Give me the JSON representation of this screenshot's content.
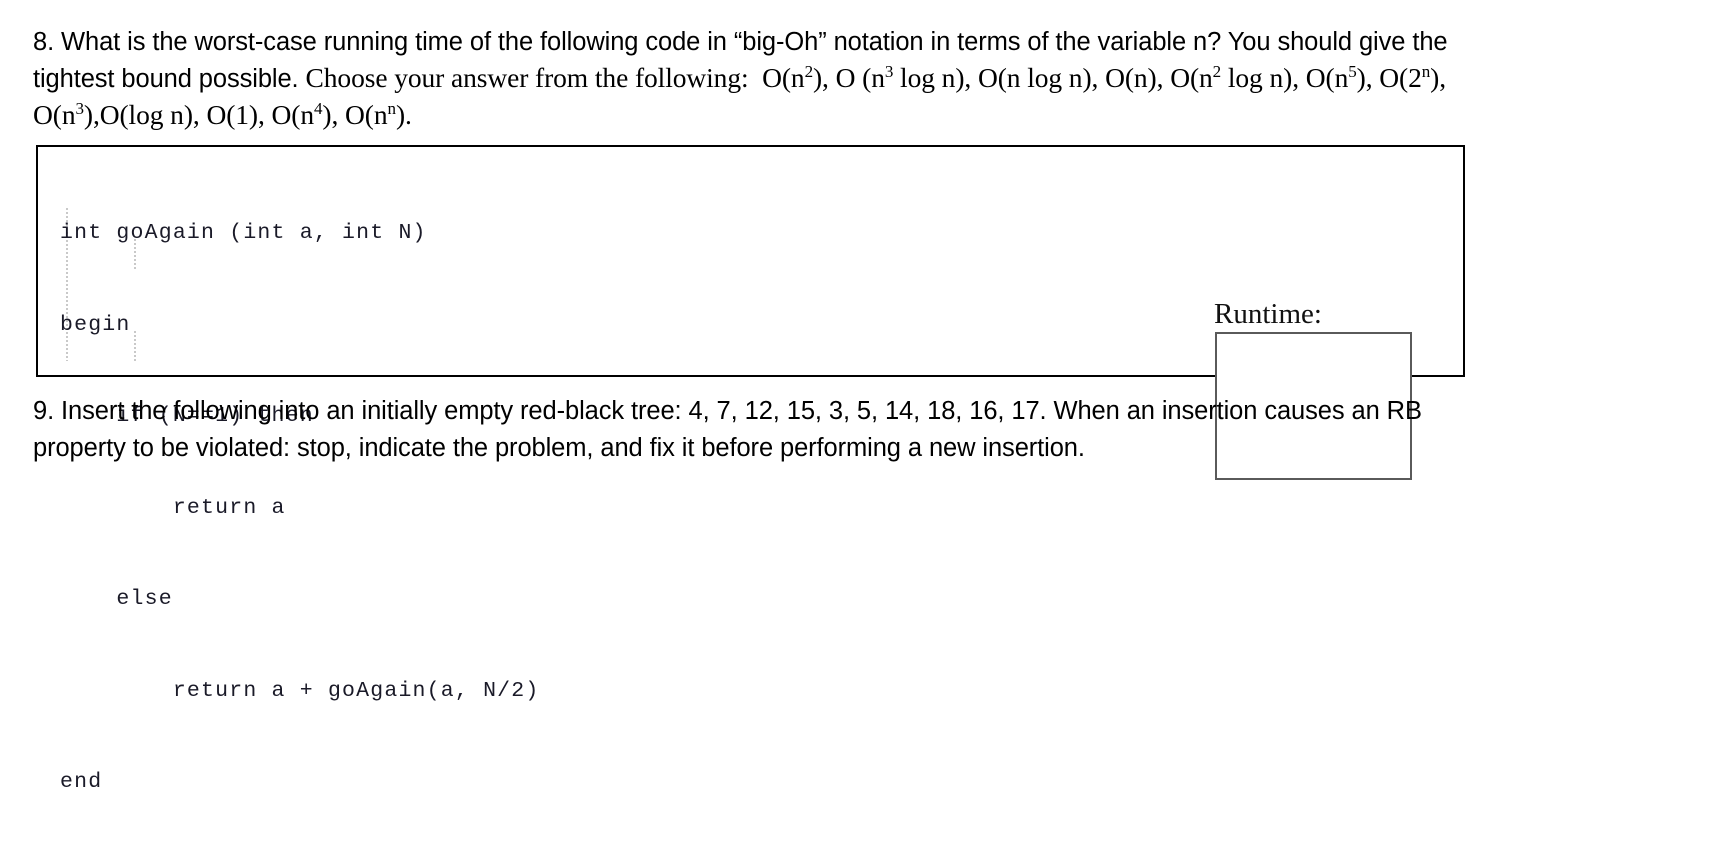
{
  "document": {
    "type": "exam-worksheet",
    "background_color": "#ffffff",
    "text_color": "#000000"
  },
  "question8": {
    "number": "8.",
    "prompt_part1": "8. What is the worst-case running time of the following code in “big-Oh” notation in terms of the variable n? You should give the tightest bound possible. Choose your answer from the following:",
    "sans_intro": "8. What is the worst-case running time of the following code in “big-Oh” notation in terms of the variable n? You should give the tightest bound possible. ",
    "serif_lead": "Choose your answer from the following:",
    "choices": [
      "O(n²)",
      "O (n³ log n)",
      "O(n log n)",
      "O(n)",
      "O(n² log n)",
      "O(n⁵)",
      "O(2ⁿ)",
      "O(n³)",
      "O(log n)",
      "O(1)",
      "O(n⁴)",
      "O(nⁿ)"
    ],
    "code_lines": [
      "int goAgain (int a, int N)",
      "begin",
      "    if (N==1) then",
      "        return a",
      "    else",
      "        return a + goAgain(a, N/2)",
      "end"
    ],
    "runtime_label": "Runtime:",
    "runtime_answer": "",
    "border_color": "#000000",
    "answer_box_border_color": "#5a5a5a"
  },
  "question9": {
    "number": "9.",
    "prompt": "9. Insert the following into an initially empty red-black tree: 4, 7, 12, 15, 3, 5, 14, 18, 16, 17. When an insertion causes an RB property to be violated: stop, indicate the problem, and fix it before performing a new insertion.",
    "insert_sequence": [
      4,
      7,
      12,
      15,
      3,
      5,
      14,
      18,
      16,
      17
    ]
  }
}
